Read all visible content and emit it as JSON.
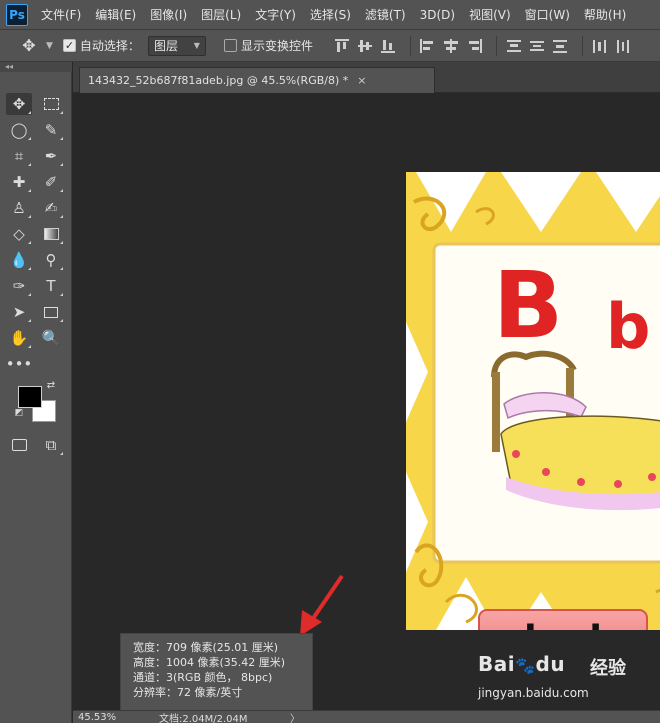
{
  "app": {
    "logo": "Ps"
  },
  "menu": [
    "文件(F)",
    "编辑(E)",
    "图像(I)",
    "图层(L)",
    "文字(Y)",
    "选择(S)",
    "滤镜(T)",
    "3D(D)",
    "视图(V)",
    "窗口(W)",
    "帮助(H)"
  ],
  "options": {
    "auto_select_label": "自动选择：",
    "auto_select_checked": true,
    "target_select_value": "图层",
    "show_transform_label": "显示变换控件",
    "show_transform_checked": false
  },
  "document": {
    "tab_title": "143432_52b687f81adeb.jpg @ 45.5%(RGB/8) *",
    "close_glyph": "×"
  },
  "image_content": {
    "big_letter": "B",
    "small_letter": "b",
    "word": "bed"
  },
  "info_popup": {
    "width": "宽度：709 像素(25.01 厘米)",
    "height": "高度：1004 像素(35.42 厘米)",
    "channels": "通道：3(RGB 颜色， 8bpc)",
    "resolution": "分辨率：72 像素/英寸"
  },
  "status": {
    "zoom": "45.53%",
    "doc": "文档:2.04M/2.04M",
    "chevron": "〉"
  },
  "watermark": {
    "brand": "Bai",
    "brand_end": "du",
    "suffix": "经验",
    "url": "jingyan.baidu.com"
  },
  "colors": {
    "accent_arrow": "#e02b2b",
    "ui_bg": "#535353",
    "canvas_bg": "#282828"
  }
}
